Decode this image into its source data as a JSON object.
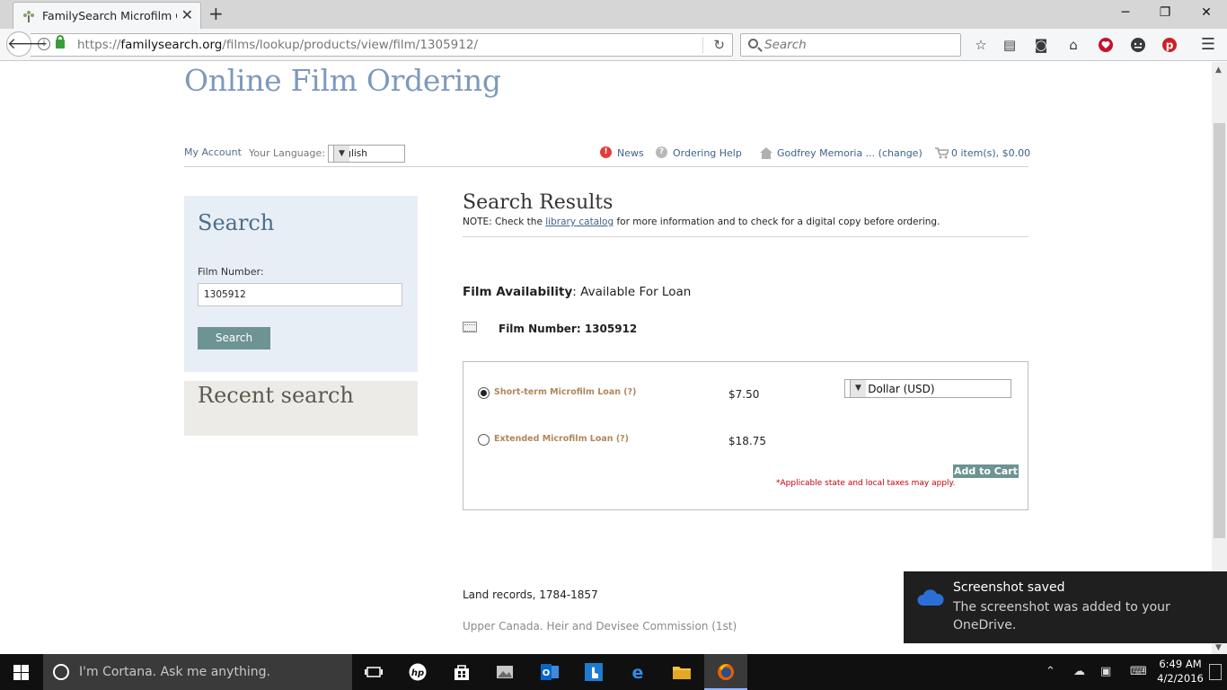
{
  "browser": {
    "tab_title": "FamilySearch Microfilm O...",
    "tab_close": "✕",
    "new_tab": "+",
    "url_prefix": "https://",
    "url_host": "familysearch.org",
    "url_path": "/films/lookup/products/view/film/1305912/",
    "search_placeholder": "Search"
  },
  "page": {
    "title": "Online Film Ordering",
    "util": {
      "my_account": "My Account",
      "language_label": "Your Language:",
      "language_value": "English",
      "news": "News",
      "ordering_help": "Ordering Help",
      "library": "Godfrey Memoria ... (change)",
      "cart": "0 item(s), $0.00"
    },
    "search": {
      "heading": "Search",
      "film_number_label": "Film Number:",
      "film_number_value": "1305912",
      "button": "Search"
    },
    "recent": {
      "heading": "Recent search"
    },
    "results": {
      "heading": "Search Results",
      "note_prefix": "NOTE: Check the ",
      "note_link": "library catalog",
      "note_suffix": " for more information and to check for a digital copy before ordering.",
      "availability_label": "Film Availability",
      "availability_value": ": Available For Loan",
      "film_number": "Film Number: 1305912"
    },
    "loans": {
      "short_term_label": "Short-term Microfilm Loan (?)",
      "short_term_price": "$7.50",
      "extended_label": "Extended Microfilm Loan (?)",
      "extended_price": "$18.75",
      "currency": "US Dollar (USD)",
      "add_to_cart": "Add to Cart",
      "tax_note": "*Applicable state and local taxes may apply.",
      "selected": "short_term"
    },
    "description": {
      "line1": "Land records, 1784-1857",
      "line2": "Upper Canada. Heir and Devisee Commission (1st)"
    }
  },
  "toast": {
    "title": "Screenshot saved",
    "body": "The screenshot was added to your OneDrive."
  },
  "taskbar": {
    "cortana_placeholder": "I'm Cortana. Ask me anything.",
    "time": "6:49 AM",
    "date": "4/2/2016"
  },
  "colors": {
    "title_blue": "#7d99bd",
    "teal_button": "#6e9393",
    "loan_label": "#b1865a",
    "tax_red": "#c2000a",
    "search_panel_bg": "#e8eef6"
  }
}
